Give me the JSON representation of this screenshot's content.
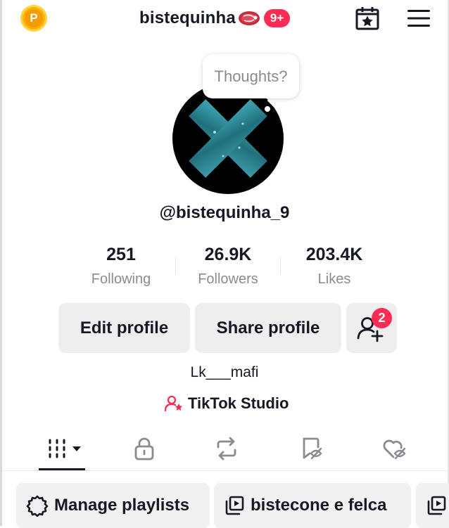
{
  "header": {
    "coin_letter": "P",
    "username_title": "bistequinha",
    "notification_badge": "9+"
  },
  "profile": {
    "bubble_text": "Thoughts?",
    "handle": "@bistequinha_9",
    "bio": "Lk___mafi",
    "studio_label": "TikTok Studio"
  },
  "stats": [
    {
      "value": "251",
      "label": "Following"
    },
    {
      "value": "26.9K",
      "label": "Followers"
    },
    {
      "value": "203.4K",
      "label": "Likes"
    }
  ],
  "actions": {
    "edit_profile": "Edit profile",
    "share_profile": "Share profile",
    "friend_requests_count": "2"
  },
  "tabs": [
    "videos-grid-icon",
    "lock-icon",
    "repost-icon",
    "bookmark-hidden-icon",
    "heart-hidden-icon"
  ],
  "playlists": {
    "manage": "Manage playlists",
    "items": [
      "bistecone e felca"
    ]
  },
  "colors": {
    "accent": "#fe2c55",
    "coin": "#f7b500",
    "avatar_x": "#2e8a9a"
  }
}
